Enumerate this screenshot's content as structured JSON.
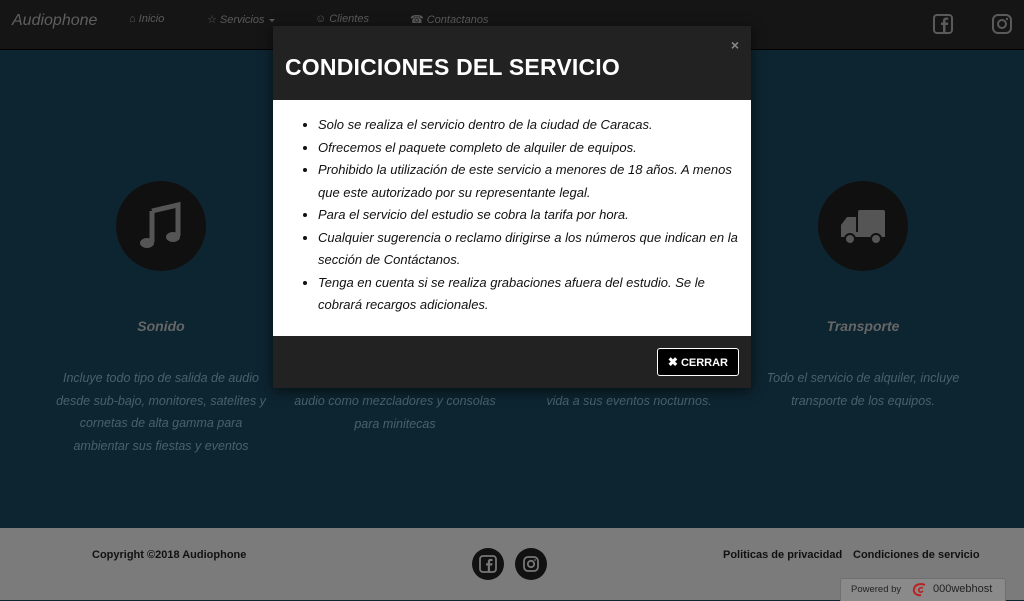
{
  "navbar": {
    "brand": "Audiophone",
    "items": [
      {
        "icon": "home-icon",
        "glyph": "⌂",
        "label": "Inicio"
      },
      {
        "icon": "star-icon",
        "glyph": "☆",
        "label": "Servicios"
      },
      {
        "icon": "users-icon",
        "glyph": "☺",
        "label": "Clientes"
      },
      {
        "icon": "phone-icon",
        "glyph": "☎",
        "label": "Contactanos"
      }
    ],
    "social": [
      "facebook-icon",
      "instagram-icon"
    ]
  },
  "services": [
    {
      "icon": "music-icon",
      "title": "Sonido",
      "desc": "Incluye todo tipo de salida de audio desde sub-bajo, monitores, satelites y cornetas de alta gamma para ambientar sus fiestas y eventos"
    },
    {
      "desc": "audio como mezcladores y consolas para minitecas"
    },
    {
      "desc": "vida a sus eventos nocturnos."
    },
    {
      "icon": "truck-icon",
      "title": "Transporte",
      "desc": "Todo el servicio de alquiler, incluye transporte de los equipos."
    }
  ],
  "footer": {
    "copyright": "Copyright ©2018 Audiophone",
    "privacy": "Politicas de privacidad",
    "terms": "Condiciones de servicio",
    "powered_prefix": "Powered by",
    "powered_brand": "000webhost"
  },
  "modal": {
    "title": "CONDICIONES DEL SERVICIO",
    "close_x": "×",
    "items": [
      "Solo se realiza el servicio dentro de la ciudad de Caracas.",
      "Ofrecemos el paquete completo de alquiler de equipos.",
      "Prohibido la utilización de este servicio a menores de 18 años. A menos que este autorizado por su representante legal.",
      "Para el servicio del estudio se cobra la tarifa por hora.",
      "Cualquier sugerencia o reclamo dirigirse a los números que indican en la sección de Contáctanos.",
      "Tenga en cuenta si se realiza grabaciones afuera del estudio. Se le cobrará recargos adicionales."
    ],
    "button_label": "CERRAR"
  },
  "colors": {
    "navbar": "#151515",
    "hero": "#0d2531",
    "footer": "#7b7b7b",
    "modal_header": "#222222"
  }
}
